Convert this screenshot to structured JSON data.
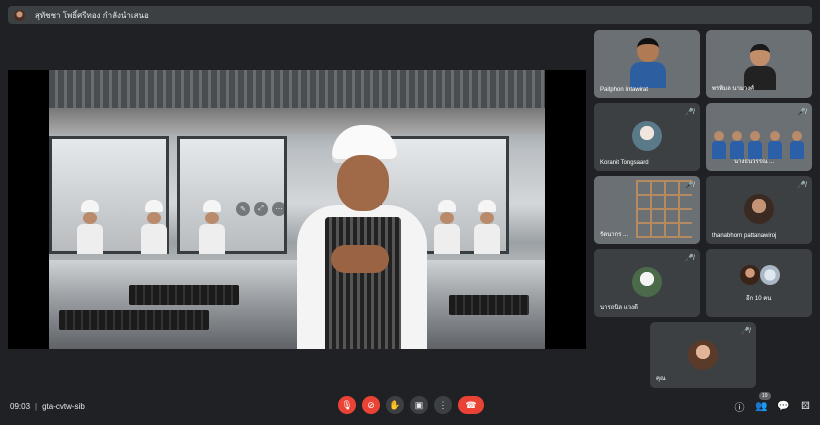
{
  "presentation": {
    "presenter_label": "สุทัชชา โพธิ์ศรีทอง กำลังนำเสนอ"
  },
  "participants": [
    {
      "name": "Paitphon Intawirat",
      "muted": false,
      "video": true
    },
    {
      "name": "พรพิมล นามวงศ์",
      "muted": false,
      "video": true
    },
    {
      "name": "Koranit Tongsaard",
      "muted": true,
      "video": false,
      "avatar_color": "#c9b29a"
    },
    {
      "name": "นางธนวรรณ ...",
      "muted": false,
      "video": true
    },
    {
      "name": "รัตนากร ...",
      "muted": true,
      "video": true
    },
    {
      "name": "thanabhorn pattanawiroj",
      "muted": true,
      "video": false,
      "avatar_color": "#6b4a3a"
    },
    {
      "name": "นารถนิล แวงดี",
      "muted": true,
      "video": false,
      "avatar_color": "#7c8a6a"
    },
    {
      "name": "อีก 10 คน",
      "muted": false,
      "video": false
    },
    {
      "name": "คุณ",
      "muted": true,
      "video": false,
      "avatar_color": "#d8a88a"
    }
  ],
  "bottom_bar": {
    "time": "09:03",
    "separator": "|",
    "meeting_code": "gta-cvtw-sib",
    "participant_count": "19"
  },
  "icons": {
    "mute": "mic-off-icon",
    "video_off": "videocam-off-icon",
    "hand": "raise-hand-icon",
    "present": "present-icon",
    "more": "more-options-icon",
    "end": "end-call-icon",
    "info": "info-icon",
    "people": "people-icon",
    "chat": "chat-icon",
    "activities": "activities-icon"
  },
  "colors": {
    "background": "#202124",
    "tile": "#3c4043",
    "danger": "#ea4335"
  }
}
